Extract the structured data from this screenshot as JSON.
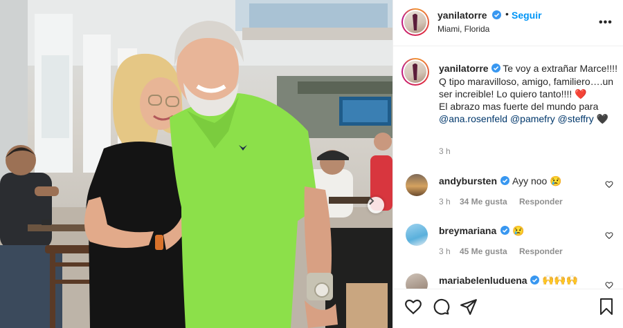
{
  "post": {
    "author": "yanilatorre",
    "follow_label": "Seguir",
    "separator": "•",
    "location": "Miami, Florida",
    "more_label": "•••",
    "caption": {
      "text_1": " Te voy a extrañar Marce!!!! Q tipo maravilloso, amigo, familiero….un ser increible! Lo quiero tanto!!!! ",
      "emoji_1": "❤️",
      "text_2": "El abrazo mas fuerte del mundo para ",
      "mention_1": "@ana.rosenfeld",
      "mention_2": "@pamefry",
      "mention_3": "@steffry",
      "emoji_2": "🖤"
    },
    "time": "3 h"
  },
  "comments": [
    {
      "user": "andybursten",
      "text": "Ayy noo 😢",
      "time": "3 h",
      "likes": "34 Me gusta",
      "reply": "Responder"
    },
    {
      "user": "breymariana",
      "text": "😢",
      "time": "3 h",
      "likes": "45 Me gusta",
      "reply": "Responder"
    },
    {
      "user": "mariabelenluduena",
      "text": "🙌🙌🙌"
    }
  ],
  "icons": {
    "verified": "verified-badge-icon",
    "like": "heart-icon",
    "comment": "comment-icon",
    "share": "share-icon",
    "save": "bookmark-icon",
    "next": "chevron-right-icon",
    "more": "more-options-icon"
  },
  "colors": {
    "link_blue": "#0095f6",
    "verified_blue": "#3897f0",
    "mention": "#00376b",
    "muted": "#8e8e8e",
    "shirt_green": "#8ce04a"
  }
}
